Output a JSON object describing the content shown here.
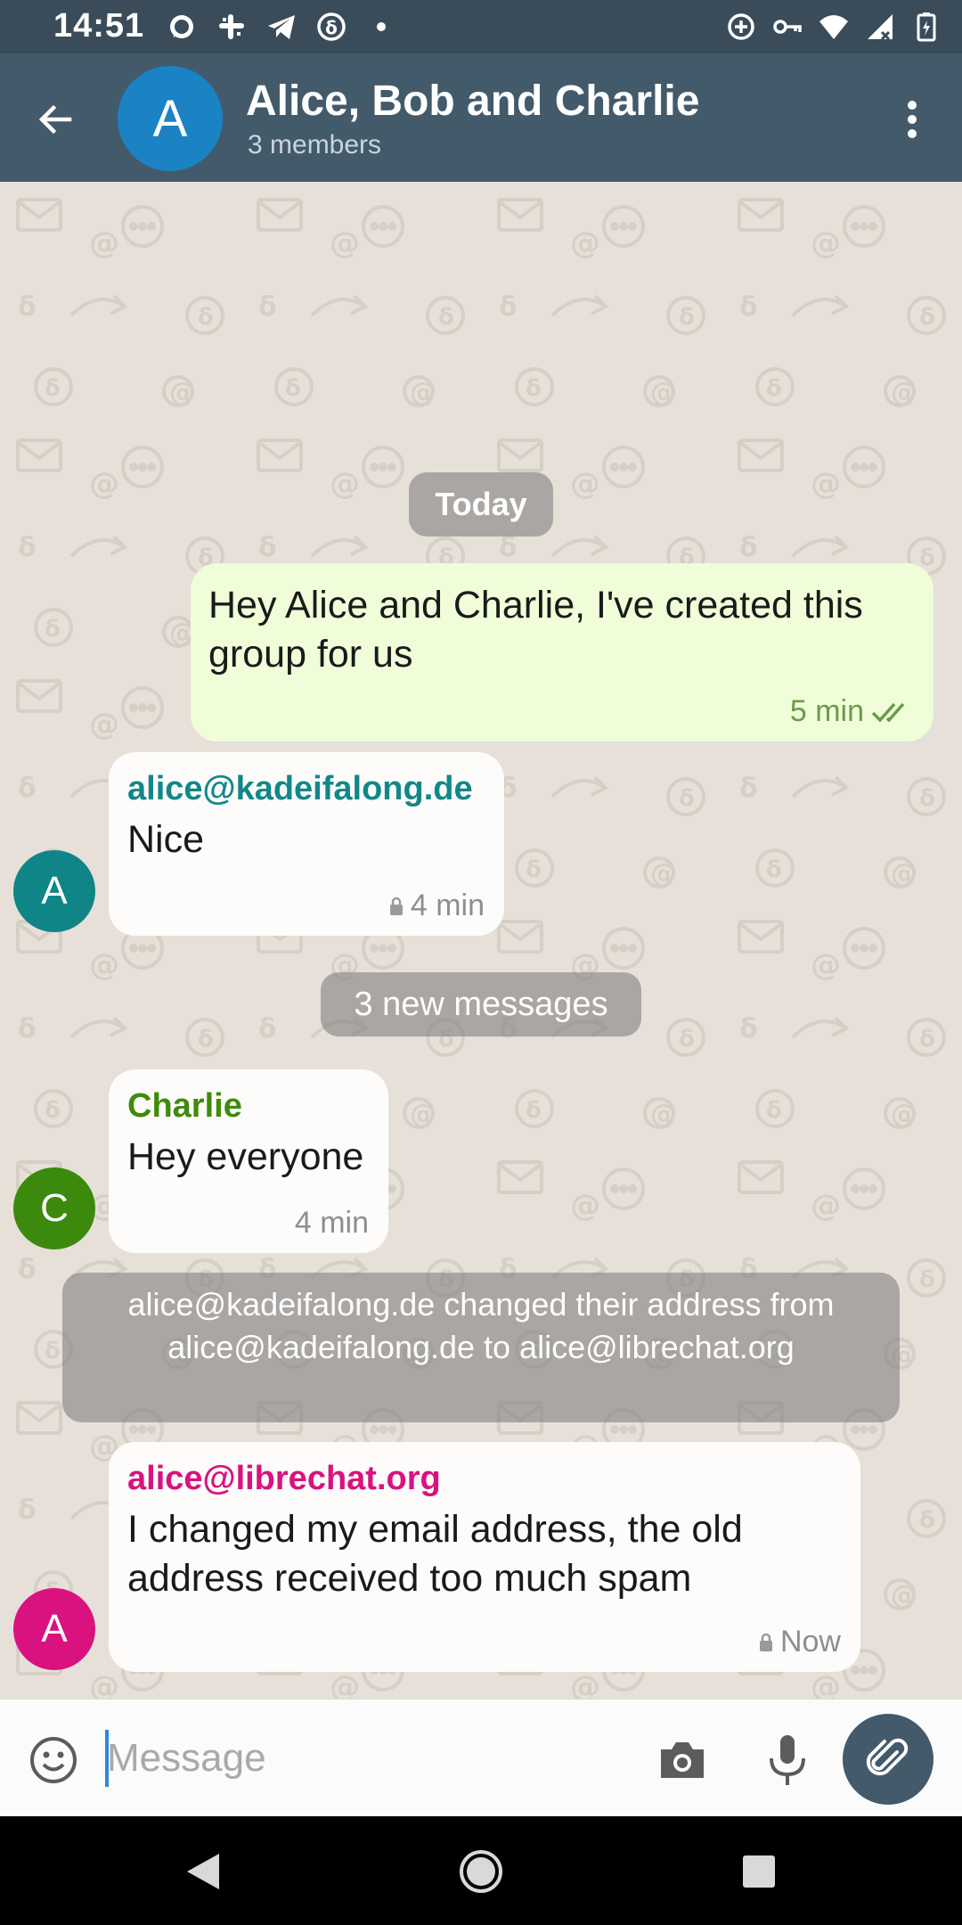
{
  "status_bar": {
    "time": "14:51",
    "left_icons": [
      "signal-app-icon",
      "slack-icon",
      "telegram-icon",
      "deltachat-icon",
      "dot-icon"
    ],
    "right_icons": [
      "data-saver-icon",
      "vpn-key-icon",
      "wifi-icon",
      "cell-signal-icon",
      "battery-icon"
    ]
  },
  "header": {
    "avatar_letter": "A",
    "title": "Alice, Bob and Charlie",
    "subtitle": "3 members",
    "avatar_color": "#1b82c4"
  },
  "chat": {
    "date_separator": "Today",
    "messages": [
      {
        "direction": "outgoing",
        "text": "Hey Alice and Charlie, I've created this group for us",
        "time": "5 min",
        "status": "double-check-icon"
      },
      {
        "direction": "incoming",
        "avatar_letter": "A",
        "sender": "alice@kadeifalong.de",
        "sender_color": "#128789",
        "text": "Nice",
        "time": "4 min",
        "encrypted": true
      },
      {
        "direction": "incoming",
        "avatar_letter": "C",
        "sender": "Charlie",
        "sender_color": "#3e8b0c",
        "text": "Hey everyone",
        "time": "4 min",
        "encrypted": false
      },
      {
        "direction": "incoming",
        "avatar_letter": "A",
        "sender": "alice@librechat.org",
        "sender_color": "#d9127f",
        "text": "I changed my email address, the old address received too much spam",
        "time": "Now",
        "encrypted": true
      }
    ],
    "new_messages_label": "3 new messages",
    "info_message": "alice@kadeifalong.de changed their address from alice@kadeifalong.de to alice@librechat.org"
  },
  "composer": {
    "placeholder": "Message",
    "value": ""
  },
  "colors": {
    "header": "#435a6b",
    "status_bar": "#3a4c59",
    "outgoing_bubble": "#effed8",
    "incoming_bubble": "#fdfcfa"
  }
}
